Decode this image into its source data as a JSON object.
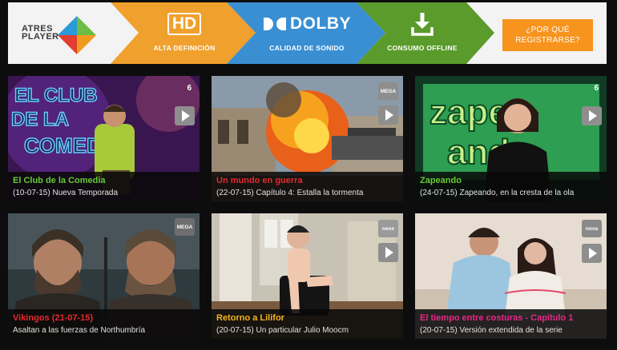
{
  "banner": {
    "logo_line1": "ATRES",
    "logo_line2": "PLAYER",
    "features": [
      {
        "icon": "hd-icon",
        "icon_text": "HD",
        "label": "ALTA DEFINICIÓN"
      },
      {
        "icon": "dolby-icon",
        "icon_text": "DOLBY",
        "label": "CALIDAD DE SONIDO"
      },
      {
        "icon": "download-icon",
        "label": "CONSUMO OFFLINE"
      }
    ],
    "cta_line1": "¿POR QUÉ",
    "cta_line2": "REGISTRARSE?",
    "colors": {
      "orange": "#f0a02c",
      "blue": "#3a8fd3",
      "green": "#5a9b2c",
      "cta": "#f7941d"
    }
  },
  "tiles": [
    {
      "title": "El Club de la Comedia",
      "subtitle": "(10-07-15) Nueva Temporada",
      "title_color": "#66cc33",
      "thumb_text": "EL CLUB DE LA COMEDIA",
      "channel_icon": "laSexta-icon"
    },
    {
      "title": "Un mundo en guerra",
      "subtitle": "(22-07-15) Capítulo 4: Estalla la tormenta",
      "title_color": "#e8282e",
      "badge": "MEGA"
    },
    {
      "title": "Zapeando",
      "subtitle": "(24-07-15) Zapeando, en la cresta de la ola",
      "title_color": "#66cc33",
      "thumb_text": "zapeando",
      "channel_icon": "laSexta-icon"
    },
    {
      "title": "Vikingos (21-07-15)",
      "subtitle": "Asaltan a las fuerzas de Northumbría",
      "title_color": "#e8282e",
      "badge": "MEGA"
    },
    {
      "title": "Retorno a Lilifor",
      "subtitle": "(20-07-15) Un particular Julio Moocm",
      "title_color": "#f7b51e",
      "badge": "neox"
    },
    {
      "title": "El tiempo entre costuras - Capítulo 1",
      "subtitle": "(20-07-15) Versión extendida de la serie",
      "title_color": "#e8288a",
      "badge": "nova"
    }
  ]
}
